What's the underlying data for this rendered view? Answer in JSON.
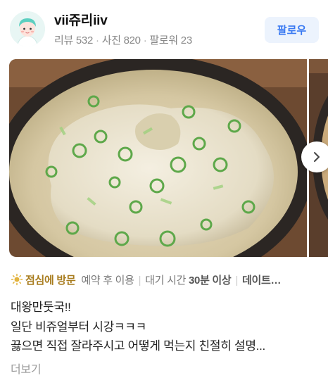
{
  "user": {
    "name": "vii쥬리iiv",
    "reviews": "리뷰 532",
    "photos": "사진 820",
    "followers": "팔로워 23"
  },
  "follow_button": "팔로우",
  "tags": {
    "visit": "점심에 방문",
    "reservation": "예약 후 이용",
    "wait_prefix": "대기 시간",
    "wait_value": "30분 이상",
    "truncated": "데이트…"
  },
  "review": {
    "lines": [
      "대왕만둣국!!",
      "일단 비쥬얼부터 시강ㅋㅋㅋ",
      "끓으면 직접 잘라주시고 어떻게 먹는지 친절히 설명..."
    ],
    "more_label": "더보기"
  },
  "icons": {
    "sun": "sun-icon",
    "next": "chevron-right-icon",
    "avatar": "avatar-illustration"
  },
  "colors": {
    "accent": "#3a7af2",
    "visit": "#a87c1e"
  }
}
